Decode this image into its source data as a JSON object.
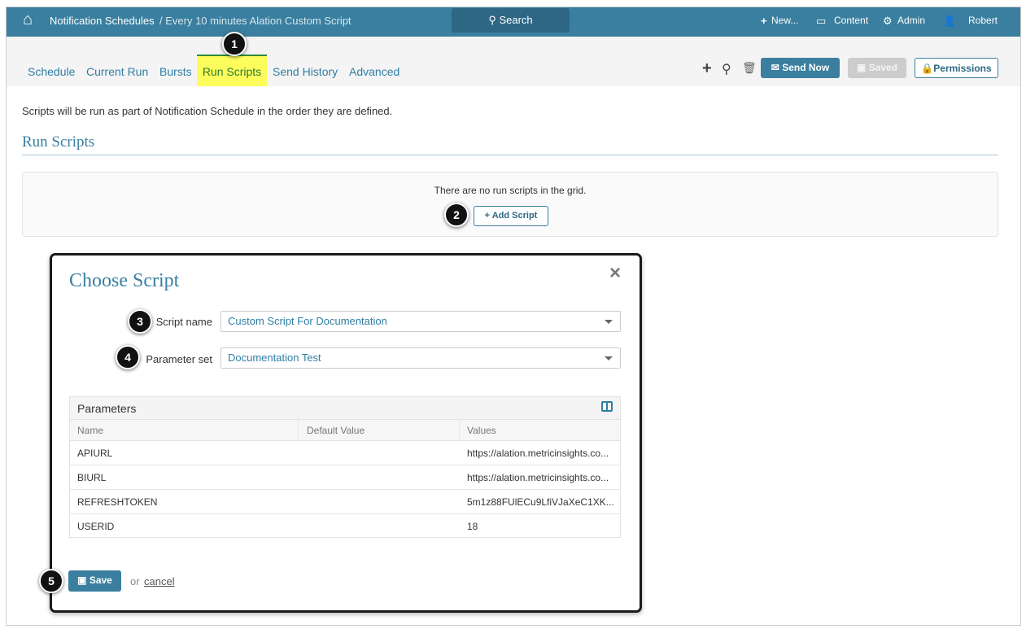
{
  "header": {
    "breadcrumb_root": "Notification Schedules",
    "breadcrumb_current": "/ Every 10 minutes Alation Custom Script",
    "search": "Search",
    "new": "New...",
    "content": "Content",
    "admin": "Admin",
    "user": "Robert"
  },
  "tabs": [
    "Schedule",
    "Current Run",
    "Bursts",
    "Run Scripts",
    "Send History",
    "Advanced"
  ],
  "toolbar": {
    "send_now": "Send Now",
    "saved": "Saved",
    "permissions": "Permissions"
  },
  "page": {
    "description": "Scripts will be run as part of Notification Schedule in the order they are defined.",
    "section_title": "Run Scripts",
    "empty_text": "There are no run scripts in the grid.",
    "add_script": "Add Script"
  },
  "modal": {
    "title": "Choose Script",
    "script_name_label": "Script name",
    "script_name_value": "Custom Script For Documentation",
    "parameter_set_label": "Parameter set",
    "parameter_set_value": "Documentation Test",
    "parameters_title": "Parameters",
    "columns": [
      "Name",
      "Default Value",
      "Values"
    ],
    "rows": [
      {
        "name": "APIURL",
        "default": "",
        "value": "https://alation.metricinsights.co..."
      },
      {
        "name": "BIURL",
        "default": "",
        "value": "https://alation.metricinsights.co..."
      },
      {
        "name": "REFRESHTOKEN",
        "default": "",
        "value": "5m1z88FUlECu9LfiVJaXeC1XK..."
      },
      {
        "name": "USERID",
        "default": "",
        "value": "18"
      }
    ],
    "save": "Save",
    "or": "or",
    "cancel": "cancel"
  },
  "callouts": [
    "1",
    "2",
    "3",
    "4",
    "5"
  ],
  "colors": {
    "header": "#3a7f9f",
    "accent": "#2f7ea6",
    "highlight": "#fcfc5c"
  }
}
